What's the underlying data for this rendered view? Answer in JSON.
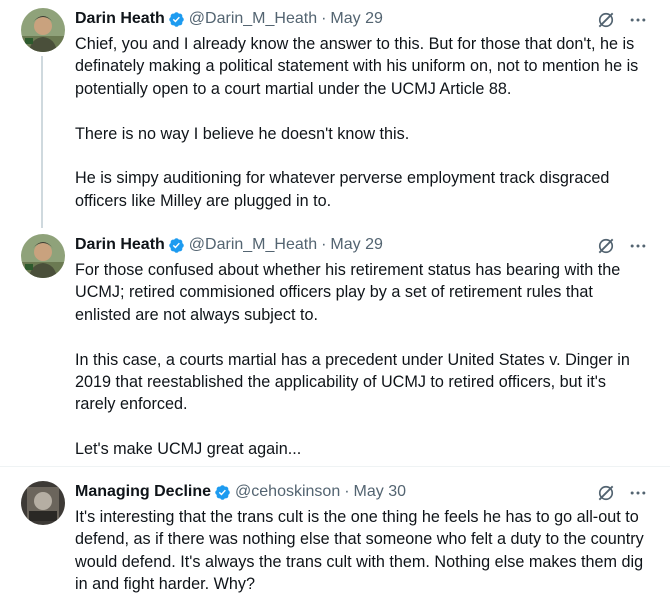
{
  "tweets": [
    {
      "name": "Darin Heath",
      "handle": "@Darin_M_Heath",
      "date": "May 29",
      "paragraphs": [
        "Chief, you and I already know the answer to this.  But for those that don't, he is definately making a political statement with his uniform on, not to mention he is potentially open to a court martial under the UCMJ Article 88.",
        "There is no way I believe he doesn't know this.",
        "He is simpy auditioning for whatever perverse employment track disgraced officers like Milley are plugged in to."
      ]
    },
    {
      "name": "Darin Heath",
      "handle": "@Darin_M_Heath",
      "date": "May 29",
      "paragraphs": [
        "For those confused about whether his retirement status has bearing with the UCMJ; retired commisioned officers play by a set of retirement rules that enlisted are not always subject to.",
        "In this case, a courts martial has a precedent under United States v. Dinger in 2019 that reestablished the applicability of UCMJ to retired officers, but it's rarely enforced.",
        "Let's make UCMJ great again..."
      ]
    },
    {
      "name": "Managing Decline",
      "handle": "@cehoskinson",
      "date": "May 30",
      "paragraphs": [
        "It's interesting that the trans cult is the one thing he feels he has to go all-out to defend, as if there was nothing else that someone who felt a duty to the country would defend. It's always the trans cult with them. Nothing else makes them dig in and fight harder. Why?"
      ]
    }
  ],
  "separator_dot": "·",
  "colors": {
    "verified": "#1d9bf0",
    "muted": "#536471",
    "text": "#0f1419",
    "thread_line": "#cfd9de"
  },
  "icons": [
    "verified-badge-icon",
    "grok-icon",
    "more-icon"
  ]
}
